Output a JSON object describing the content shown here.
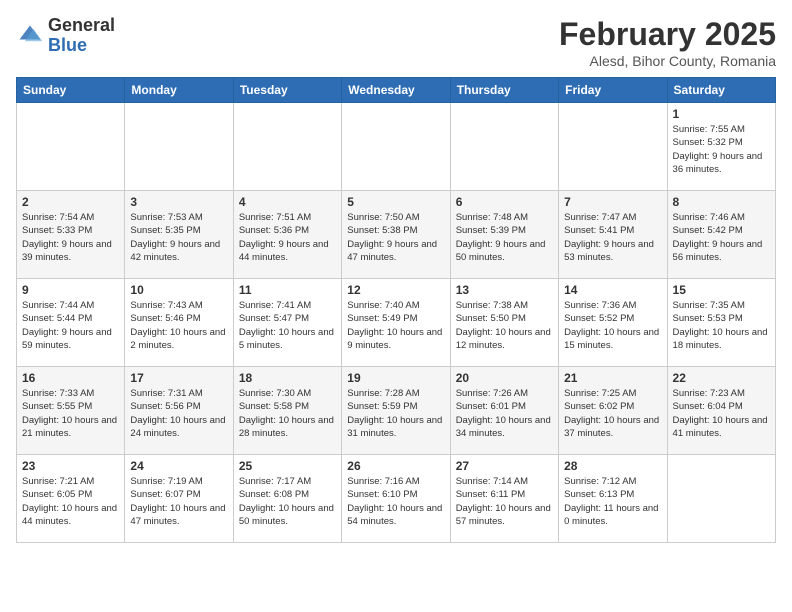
{
  "header": {
    "logo_general": "General",
    "logo_blue": "Blue",
    "month_title": "February 2025",
    "location": "Alesd, Bihor County, Romania"
  },
  "weekdays": [
    "Sunday",
    "Monday",
    "Tuesday",
    "Wednesday",
    "Thursday",
    "Friday",
    "Saturday"
  ],
  "weeks": [
    [
      {
        "day": "",
        "info": ""
      },
      {
        "day": "",
        "info": ""
      },
      {
        "day": "",
        "info": ""
      },
      {
        "day": "",
        "info": ""
      },
      {
        "day": "",
        "info": ""
      },
      {
        "day": "",
        "info": ""
      },
      {
        "day": "1",
        "info": "Sunrise: 7:55 AM\nSunset: 5:32 PM\nDaylight: 9 hours and 36 minutes."
      }
    ],
    [
      {
        "day": "2",
        "info": "Sunrise: 7:54 AM\nSunset: 5:33 PM\nDaylight: 9 hours and 39 minutes."
      },
      {
        "day": "3",
        "info": "Sunrise: 7:53 AM\nSunset: 5:35 PM\nDaylight: 9 hours and 42 minutes."
      },
      {
        "day": "4",
        "info": "Sunrise: 7:51 AM\nSunset: 5:36 PM\nDaylight: 9 hours and 44 minutes."
      },
      {
        "day": "5",
        "info": "Sunrise: 7:50 AM\nSunset: 5:38 PM\nDaylight: 9 hours and 47 minutes."
      },
      {
        "day": "6",
        "info": "Sunrise: 7:48 AM\nSunset: 5:39 PM\nDaylight: 9 hours and 50 minutes."
      },
      {
        "day": "7",
        "info": "Sunrise: 7:47 AM\nSunset: 5:41 PM\nDaylight: 9 hours and 53 minutes."
      },
      {
        "day": "8",
        "info": "Sunrise: 7:46 AM\nSunset: 5:42 PM\nDaylight: 9 hours and 56 minutes."
      }
    ],
    [
      {
        "day": "9",
        "info": "Sunrise: 7:44 AM\nSunset: 5:44 PM\nDaylight: 9 hours and 59 minutes."
      },
      {
        "day": "10",
        "info": "Sunrise: 7:43 AM\nSunset: 5:46 PM\nDaylight: 10 hours and 2 minutes."
      },
      {
        "day": "11",
        "info": "Sunrise: 7:41 AM\nSunset: 5:47 PM\nDaylight: 10 hours and 5 minutes."
      },
      {
        "day": "12",
        "info": "Sunrise: 7:40 AM\nSunset: 5:49 PM\nDaylight: 10 hours and 9 minutes."
      },
      {
        "day": "13",
        "info": "Sunrise: 7:38 AM\nSunset: 5:50 PM\nDaylight: 10 hours and 12 minutes."
      },
      {
        "day": "14",
        "info": "Sunrise: 7:36 AM\nSunset: 5:52 PM\nDaylight: 10 hours and 15 minutes."
      },
      {
        "day": "15",
        "info": "Sunrise: 7:35 AM\nSunset: 5:53 PM\nDaylight: 10 hours and 18 minutes."
      }
    ],
    [
      {
        "day": "16",
        "info": "Sunrise: 7:33 AM\nSunset: 5:55 PM\nDaylight: 10 hours and 21 minutes."
      },
      {
        "day": "17",
        "info": "Sunrise: 7:31 AM\nSunset: 5:56 PM\nDaylight: 10 hours and 24 minutes."
      },
      {
        "day": "18",
        "info": "Sunrise: 7:30 AM\nSunset: 5:58 PM\nDaylight: 10 hours and 28 minutes."
      },
      {
        "day": "19",
        "info": "Sunrise: 7:28 AM\nSunset: 5:59 PM\nDaylight: 10 hours and 31 minutes."
      },
      {
        "day": "20",
        "info": "Sunrise: 7:26 AM\nSunset: 6:01 PM\nDaylight: 10 hours and 34 minutes."
      },
      {
        "day": "21",
        "info": "Sunrise: 7:25 AM\nSunset: 6:02 PM\nDaylight: 10 hours and 37 minutes."
      },
      {
        "day": "22",
        "info": "Sunrise: 7:23 AM\nSunset: 6:04 PM\nDaylight: 10 hours and 41 minutes."
      }
    ],
    [
      {
        "day": "23",
        "info": "Sunrise: 7:21 AM\nSunset: 6:05 PM\nDaylight: 10 hours and 44 minutes."
      },
      {
        "day": "24",
        "info": "Sunrise: 7:19 AM\nSunset: 6:07 PM\nDaylight: 10 hours and 47 minutes."
      },
      {
        "day": "25",
        "info": "Sunrise: 7:17 AM\nSunset: 6:08 PM\nDaylight: 10 hours and 50 minutes."
      },
      {
        "day": "26",
        "info": "Sunrise: 7:16 AM\nSunset: 6:10 PM\nDaylight: 10 hours and 54 minutes."
      },
      {
        "day": "27",
        "info": "Sunrise: 7:14 AM\nSunset: 6:11 PM\nDaylight: 10 hours and 57 minutes."
      },
      {
        "day": "28",
        "info": "Sunrise: 7:12 AM\nSunset: 6:13 PM\nDaylight: 11 hours and 0 minutes."
      },
      {
        "day": "",
        "info": ""
      }
    ]
  ]
}
